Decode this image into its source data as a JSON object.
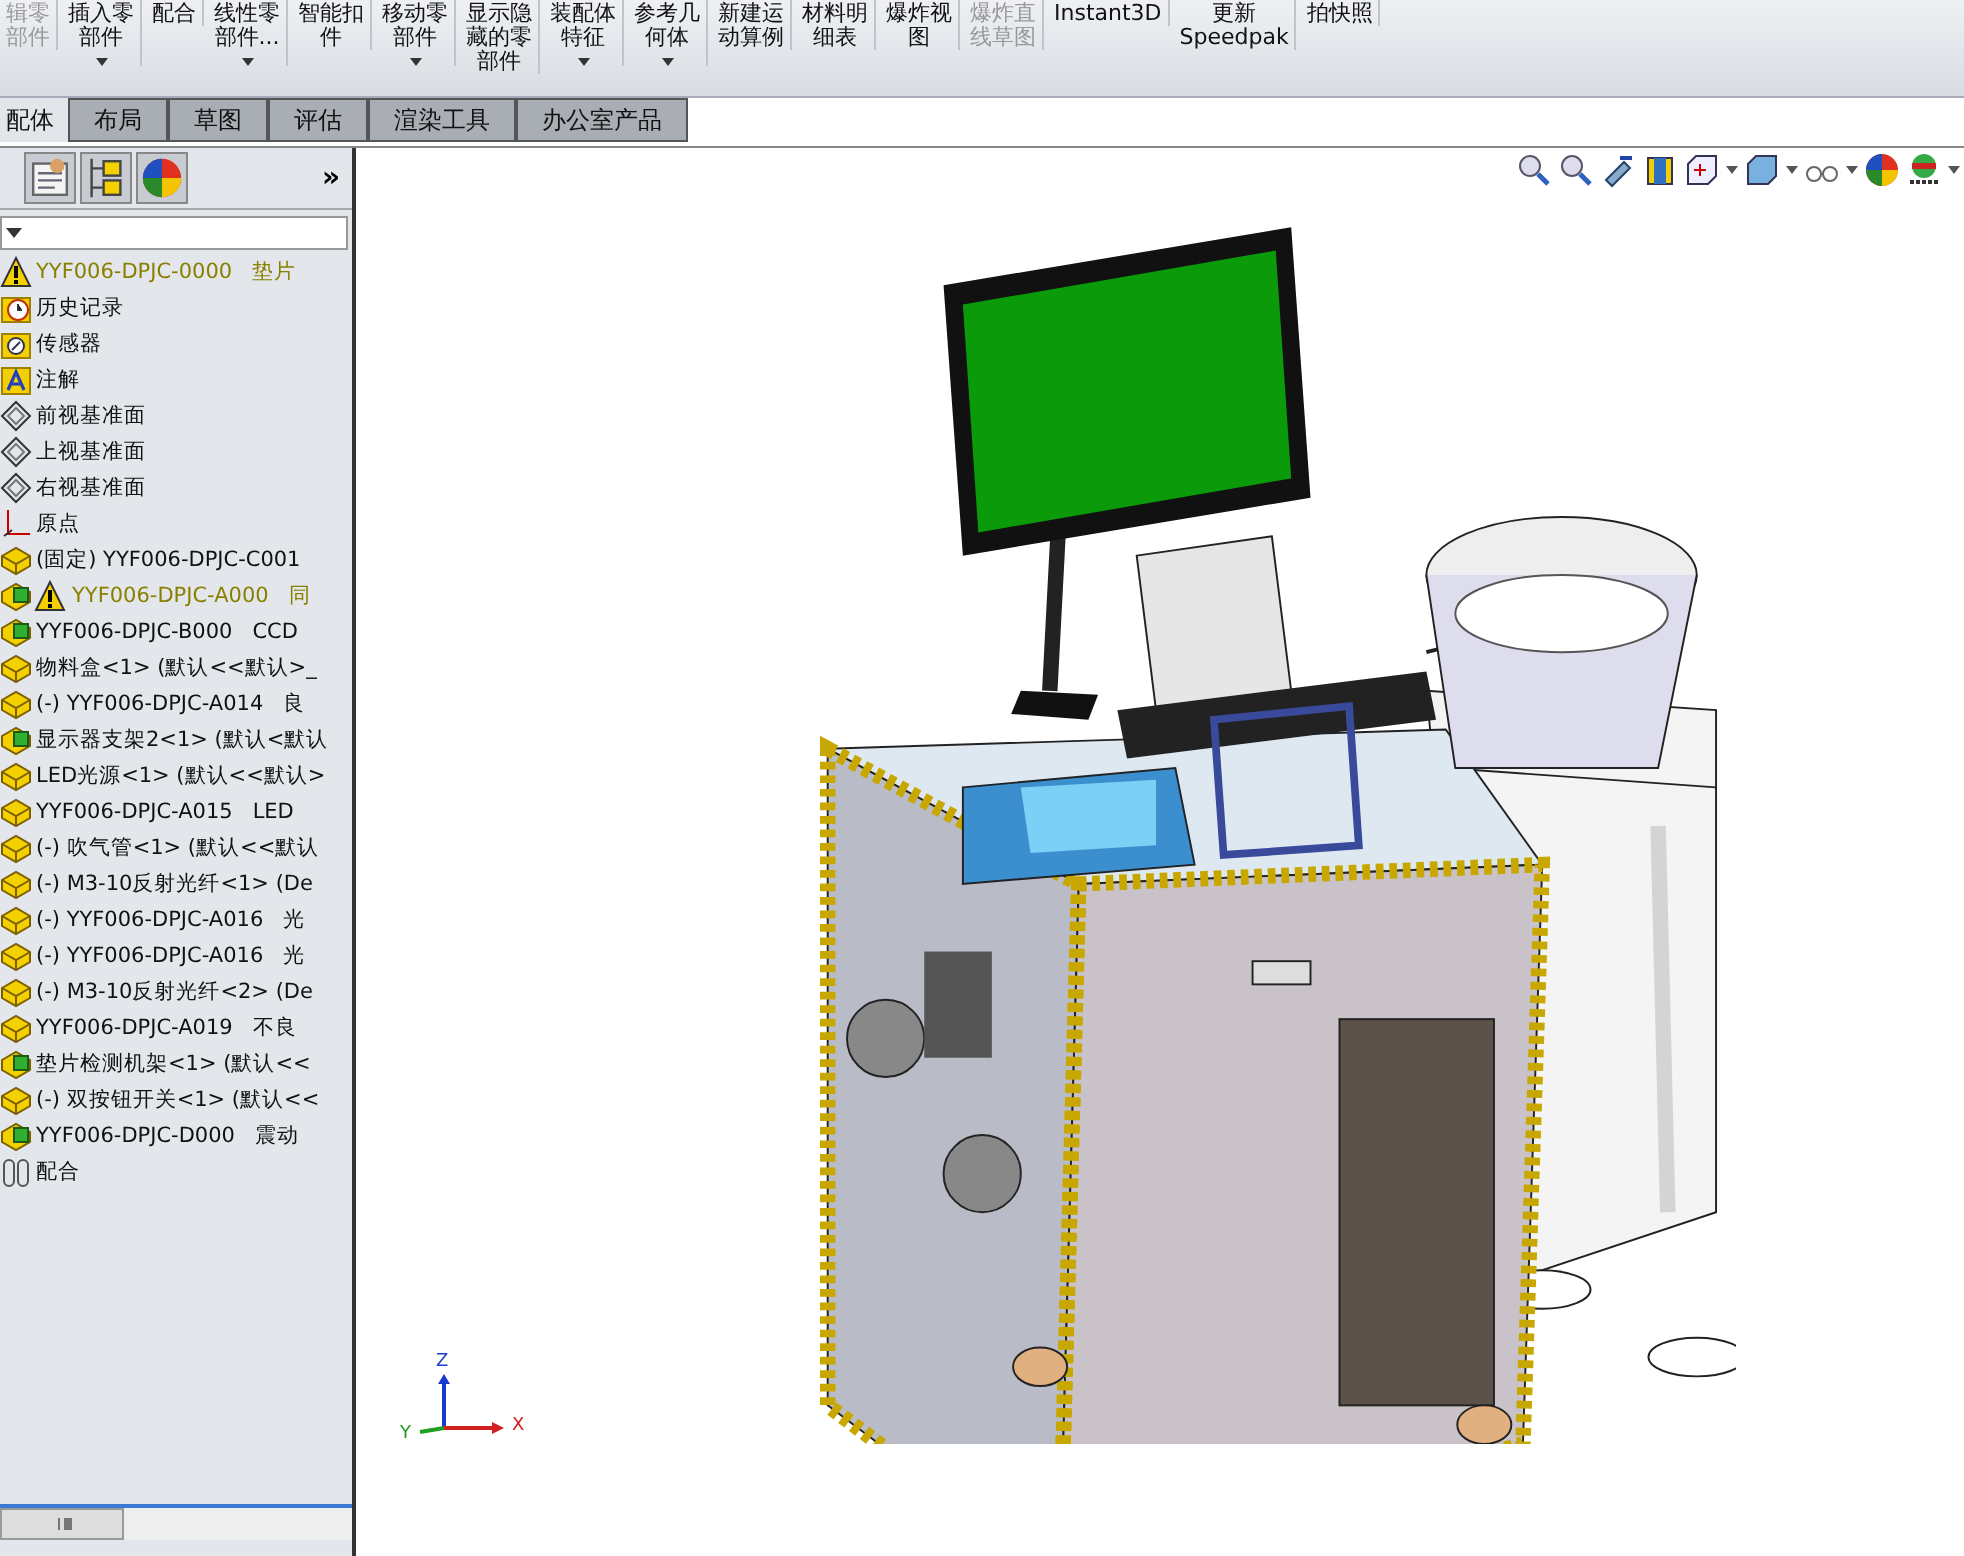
{
  "toolbar": {
    "buttons": [
      {
        "lines": [
          "辑零",
          "部件"
        ],
        "disabled": true,
        "dropdown": false
      },
      {
        "lines": [
          "插入零",
          "部件"
        ],
        "disabled": false,
        "dropdown": true
      },
      {
        "lines": [
          "配合"
        ],
        "disabled": false,
        "dropdown": false
      },
      {
        "lines": [
          "线性零",
          "部件..."
        ],
        "disabled": false,
        "dropdown": true
      },
      {
        "lines": [
          "智能扣",
          "件"
        ],
        "disabled": false,
        "dropdown": false
      },
      {
        "lines": [
          "移动零",
          "部件"
        ],
        "disabled": false,
        "dropdown": true
      },
      {
        "lines": [
          "显示隐",
          "藏的零",
          "部件"
        ],
        "disabled": false,
        "dropdown": false
      },
      {
        "lines": [
          "装配体",
          "特征"
        ],
        "disabled": false,
        "dropdown": true
      },
      {
        "lines": [
          "参考几",
          "何体"
        ],
        "disabled": false,
        "dropdown": true
      },
      {
        "lines": [
          "新建运",
          "动算例"
        ],
        "disabled": false,
        "dropdown": false
      },
      {
        "lines": [
          "材料明",
          "细表"
        ],
        "disabled": false,
        "dropdown": false
      },
      {
        "lines": [
          "爆炸视",
          "图"
        ],
        "disabled": false,
        "dropdown": false
      },
      {
        "lines": [
          "爆炸直",
          "线草图"
        ],
        "disabled": true,
        "dropdown": false
      },
      {
        "lines": [
          "Instant3D"
        ],
        "disabled": false,
        "dropdown": false
      },
      {
        "lines": [
          "更新",
          "Speedpak"
        ],
        "disabled": false,
        "dropdown": false
      },
      {
        "lines": [
          "拍快照"
        ],
        "disabled": false,
        "dropdown": false
      }
    ]
  },
  "tabs": [
    {
      "label": "配体",
      "selected": true
    },
    {
      "label": "布局",
      "selected": false
    },
    {
      "label": "草图",
      "selected": false
    },
    {
      "label": "评估",
      "selected": false
    },
    {
      "label": "渲染工具",
      "selected": false
    },
    {
      "label": "办公室产品",
      "selected": false
    }
  ],
  "panel": {
    "more": "»",
    "tree": [
      {
        "kind": "warning",
        "name": "YYF006-DPJC-0000",
        "note": "垫片"
      },
      {
        "kind": "history",
        "name": "历史记录"
      },
      {
        "kind": "sensor",
        "name": "传感器"
      },
      {
        "kind": "annotation",
        "name": "注解"
      },
      {
        "kind": "plane",
        "name": "前视基准面"
      },
      {
        "kind": "plane",
        "name": "上视基准面"
      },
      {
        "kind": "plane",
        "name": "右视基准面"
      },
      {
        "kind": "origin",
        "name": "原点"
      },
      {
        "kind": "part",
        "name": "(固定) YYF006-DPJC-C001"
      },
      {
        "kind": "assembly-warning",
        "name": "YYF006-DPJC-A000",
        "note": "同"
      },
      {
        "kind": "assembly",
        "name": "YYF006-DPJC-B000",
        "note": "CCD"
      },
      {
        "kind": "part",
        "name": "物料盒<1> (默认<<默认>_"
      },
      {
        "kind": "part",
        "name": "(-) YYF006-DPJC-A014",
        "note": "良"
      },
      {
        "kind": "assembly",
        "name": "显示器支架2<1> (默认<默认"
      },
      {
        "kind": "part",
        "name": "LED光源<1> (默认<<默认>"
      },
      {
        "kind": "part",
        "name": "YYF006-DPJC-A015",
        "note": "LED"
      },
      {
        "kind": "part",
        "name": "(-) 吹气管<1> (默认<<默认"
      },
      {
        "kind": "part",
        "name": "(-) M3-10反射光纤<1> (De"
      },
      {
        "kind": "part",
        "name": "(-) YYF006-DPJC-A016",
        "note": "光"
      },
      {
        "kind": "part",
        "name": "(-) YYF006-DPJC-A016",
        "note": "光"
      },
      {
        "kind": "part",
        "name": "(-) M3-10反射光纤<2> (De"
      },
      {
        "kind": "part",
        "name": "YYF006-DPJC-A019",
        "note": "不良"
      },
      {
        "kind": "assembly",
        "name": "垫片检测机架<1> (默认<<"
      },
      {
        "kind": "part",
        "name": "(-) 双按钮开关<1> (默认<<"
      },
      {
        "kind": "assembly",
        "name": "YYF006-DPJC-D000",
        "note": "震动"
      },
      {
        "kind": "mates",
        "name": "配合"
      }
    ]
  },
  "viewport": {
    "triad": {
      "x": "X",
      "y": "Y",
      "z": "Z"
    }
  }
}
